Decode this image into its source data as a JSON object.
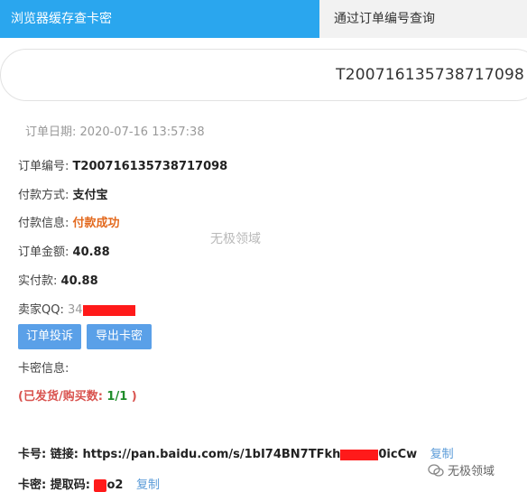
{
  "tabs": {
    "active": "浏览器缓存查卡密",
    "other": "通过订单编号查询"
  },
  "search": {
    "value": "T200716135738717098"
  },
  "order": {
    "date_label": "订单日期:",
    "date_value": "2020-07-16 13:57:38",
    "number_label": "订单编号:",
    "number_value": "T200716135738717098",
    "pay_method_label": "付款方式:",
    "pay_method_value": "支付宝",
    "pay_info_label": "付款信息:",
    "pay_info_value": "付款成功",
    "amount_label": "订单金额:",
    "amount_value": "40.88",
    "paid_label": "实付款:",
    "paid_value": "40.88",
    "seller_qq_label": "卖家QQ:",
    "seller_qq_value": "34"
  },
  "buttons": {
    "complain": "订单投诉",
    "export": "导出卡密"
  },
  "card": {
    "info_label": "卡密信息:",
    "shipped_text": "(已发货/购买数:",
    "shipped_count": "1/1",
    "shipped_close": ")",
    "number_label": "卡号:",
    "link_label": "链接:",
    "link_start": "https://pan.baidu.com/s/1bI74BN7TFkh",
    "link_end": "0icCw",
    "secret_label": "卡密:",
    "code_label": "提取码:",
    "code_end": "o2",
    "copy_label": "复制"
  },
  "watermarks": {
    "center": "无极领域",
    "corner": "无极领域"
  }
}
